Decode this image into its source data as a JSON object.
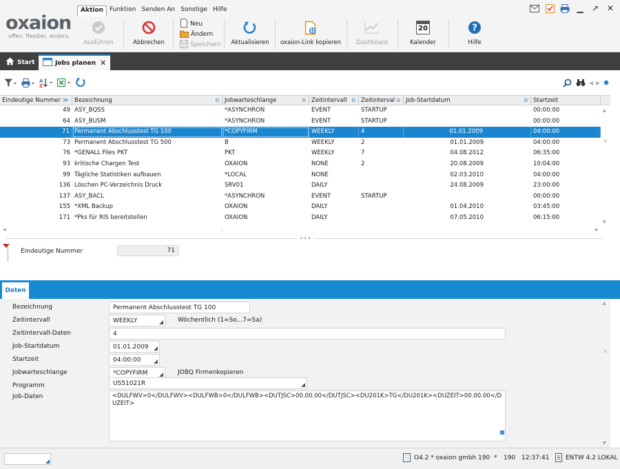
{
  "brand": {
    "logo_text": "oxaion",
    "slogan": "offen. flexibel. anders."
  },
  "menu": [
    "Aktion",
    "Funktion",
    "Senden An",
    "Sonstige",
    "Hilfe"
  ],
  "toolbar": {
    "ausfuehren": "Ausführen",
    "abbrechen": "Abbrechen",
    "neu": "Neu",
    "aendern": "Ändern",
    "speichern": "Speichern",
    "aktualisieren": "Aktualisieren",
    "link": "oxaion-Link kopieren",
    "dashboard": "Dashboard",
    "kalender": "Kalender",
    "kalender_day": "20",
    "hilfe": "Hilfe"
  },
  "tabs": {
    "start": "Start",
    "jobs": "Jobs planen"
  },
  "table": {
    "columns": [
      "Eindeutige Nummer",
      "Bezeichnung",
      "Jobwarteschlange",
      "Zeitintervall",
      "Zeitinterval",
      "Job-Startdatum",
      "Startzeit"
    ],
    "rows": [
      {
        "nr": "49",
        "bez": "ASY_BQSS",
        "queue": "*ASYNCHRON",
        "interval": "EVENT",
        "daten": "STARTUP",
        "datum": "",
        "zeit": "00:00:00"
      },
      {
        "nr": "64",
        "bez": "ASY_BUSM",
        "queue": "*ASYNCHRON",
        "interval": "EVENT",
        "daten": "STARTUP",
        "datum": "",
        "zeit": "00:00:00"
      },
      {
        "nr": "71",
        "bez": "Permanent Abschlusstest TG 100",
        "queue": "*COPYFIRM",
        "interval": "WEEKLY",
        "daten": "4",
        "datum": "01.01.2009",
        "zeit": "04:00:00"
      },
      {
        "nr": "73",
        "bez": "Permanent Abschlusstest TG 500",
        "queue": "B",
        "interval": "WEEKLY",
        "daten": "2",
        "datum": "01.01.2009",
        "zeit": "04:00:00"
      },
      {
        "nr": "76",
        "bez": "*GENALL Files PKT",
        "queue": "PKT",
        "interval": "WEEKLY",
        "daten": "7",
        "datum": "04.08.2012",
        "zeit": "06:35:00"
      },
      {
        "nr": "93",
        "bez": "kritische Chargen Test",
        "queue": "OXAION",
        "interval": "NONE",
        "daten": "2",
        "datum": "20.08.2009",
        "zeit": "10:04:00"
      },
      {
        "nr": "99",
        "bez": "Tägliche Statistiken aufbauen",
        "queue": "*LOCAL",
        "interval": "NONE",
        "daten": "",
        "datum": "02.03.2010",
        "zeit": "04:00:00"
      },
      {
        "nr": "136",
        "bez": "Löschen PC-Verzeichnis Druck",
        "queue": "SRV01",
        "interval": "DAILY",
        "daten": "",
        "datum": "24.08.2009",
        "zeit": "23:00:00"
      },
      {
        "nr": "137",
        "bez": "ASY_BACL",
        "queue": "*ASYNCHRON",
        "interval": "EVENT",
        "daten": "STARTUP",
        "datum": "",
        "zeit": "00:00:00"
      },
      {
        "nr": "155",
        "bez": "*XML Backup",
        "queue": "OXAION",
        "interval": "DAILY",
        "daten": "",
        "datum": "01.04.2010",
        "zeit": "03:45:00"
      },
      {
        "nr": "171",
        "bez": "*Pks für RIS bereitstellen",
        "queue": "OXAION",
        "interval": "DAILY",
        "daten": "",
        "datum": "07.05.2010",
        "zeit": "06:15:00"
      }
    ],
    "selected_index": 2
  },
  "key": {
    "label": "Eindeutige Nummer",
    "value": "71"
  },
  "detail_tab": "Daten",
  "form": {
    "bezeichnung_label": "Bezeichnung",
    "bezeichnung": "Permanent Abschlusstest TG 100",
    "zeitintervall_label": "Zeitintervall",
    "zeitintervall": "WEEKLY",
    "zeitintervall_note": "Wöchentlich (1=So...7=Sa)",
    "zeitintervall_daten_label": "Zeitintervall-Daten",
    "zeitintervall_daten": "4",
    "startdatum_label": "Job-Startdatum",
    "startdatum": "01.01.2009",
    "startzeit_label": "Startzeit",
    "startzeit": "04:00:00",
    "queue_label": "Jobwarteschlange",
    "queue": "*COPYFIRM",
    "queue_note": "JOBQ Firmenkopieren",
    "programm_label": "Programm",
    "programm": "US51021R",
    "jobdaten_label": "Job-Daten",
    "jobdaten": "<DULFWV>0</DULFWV><DULFWB>0</DULFWB><DUTJSC>00.00.00</DUTJSC><DU201K>TG</DU201K><DUZEIT>00.00.00</DUZEIT>"
  },
  "status": {
    "system": "O4.2 * oxaion gmbh 190",
    "star": "*",
    "firm": "190",
    "time": "12:37:41",
    "env": "ENTW 4.2 LOKAL"
  },
  "colors": {
    "accent": "#1789d3",
    "selection": "#1a86d0",
    "tabbar": "#3f3f3f",
    "abbrechen_red": "#d9312e"
  }
}
